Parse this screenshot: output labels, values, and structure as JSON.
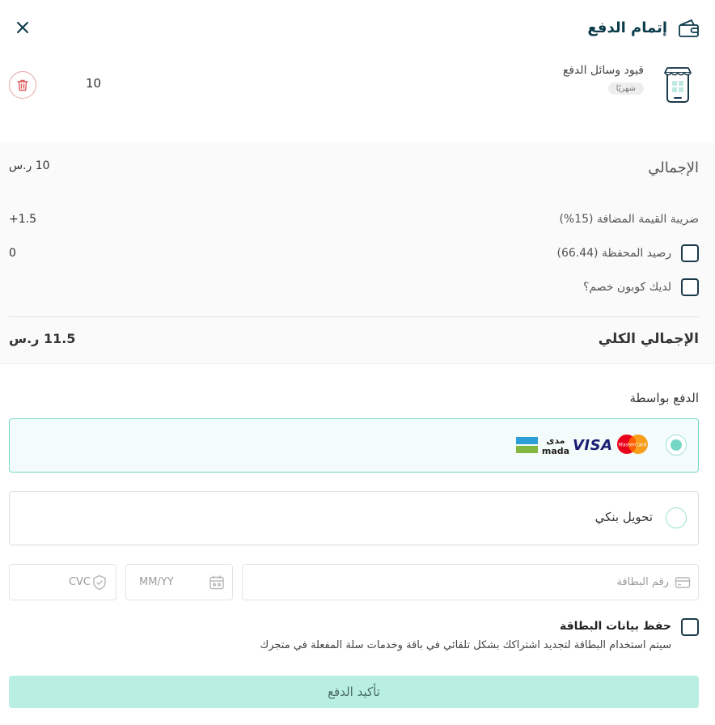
{
  "header": {
    "title": "إتمام الدفع",
    "wallet_icon": "wallet-icon",
    "close_icon": "close-icon"
  },
  "product": {
    "name": "قيود وسائل الدفع",
    "badge": "شهريًا",
    "quantity": "10",
    "icon": "store-phone-icon",
    "delete_icon": "trash-icon"
  },
  "summary": {
    "subtotal_label": "الإجمالي",
    "subtotal_value": "10 ر.س",
    "vat_label": "ضريبة القيمة المضافة (15%)",
    "vat_value": "+1.5",
    "wallet_label": "رصيد المحفظة (66.44)",
    "wallet_value": "0",
    "coupon_label": "لديك كوبون خصم؟",
    "total_label": "الإجمالي الكلي",
    "total_value": "11.5 ر.س"
  },
  "payment": {
    "heading": "الدفع بواسطة",
    "card_option": {
      "selected": true,
      "logos": [
        "mastercard-logo",
        "visa-logo",
        "mada-logo"
      ],
      "visa_text": "VISA",
      "mada_text": "mada",
      "mada_ar": "مدى",
      "mastercard_text": "MasterCard"
    },
    "bank_option": {
      "label": "تحويل بنكي",
      "selected": false
    },
    "card_number_placeholder": "رقم البطاقة",
    "expiry_placeholder": "MM/YY",
    "cvc_placeholder": "CVC",
    "save_card_label": "حفظ بيانات البطاقة",
    "save_card_note": "سيتم استخدام البطاقة لتجديد اشتراكك بشكل تلقائي في باقة وخدمات سلة المفعلة في متجرك"
  },
  "confirm_label": "تأكيد الدفع",
  "colors": {
    "accent": "#76d7c4",
    "confirm_bg": "#b8efe2",
    "header_text": "#0b3b4a",
    "danger": "#e05a5a"
  }
}
